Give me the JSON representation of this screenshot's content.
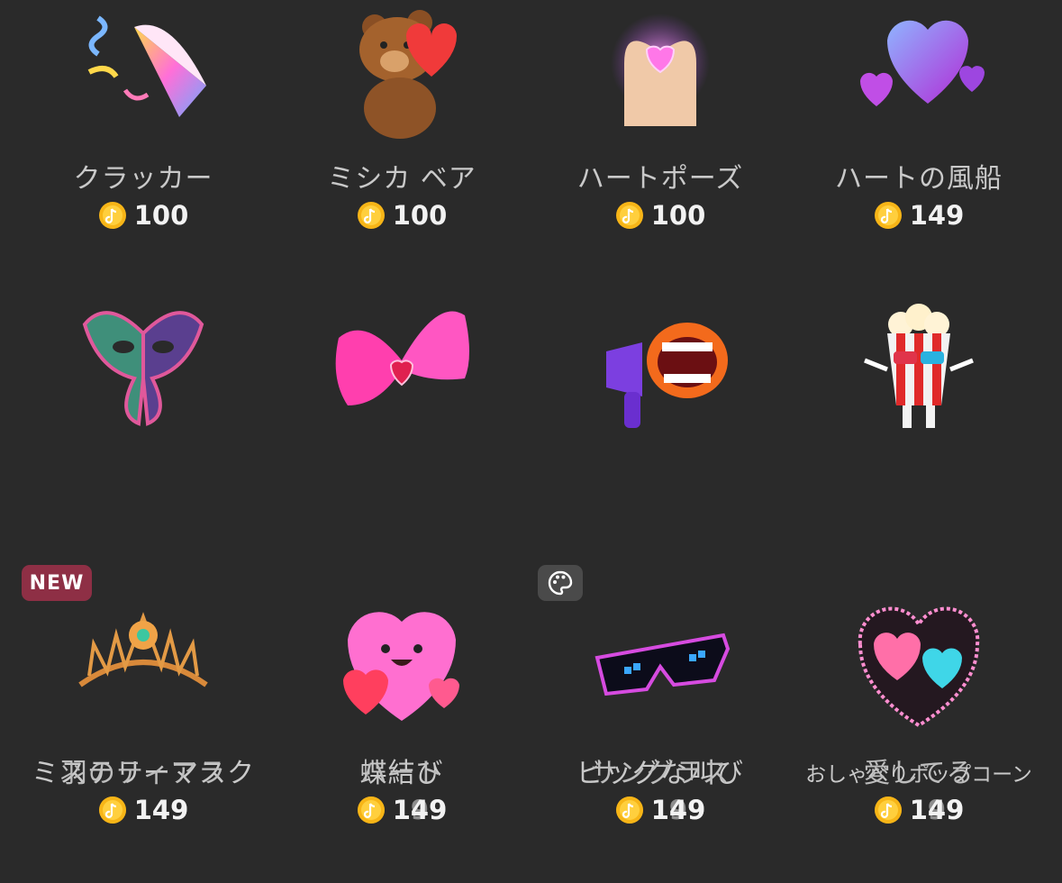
{
  "gifts": [
    {
      "name": "クラッカー",
      "price": "100",
      "icon": "party-popper-icon"
    },
    {
      "name": "ミシカ ベア",
      "price": "100",
      "icon": "teddy-bear-heart-icon"
    },
    {
      "name": "ハートポーズ",
      "price": "100",
      "icon": "heart-hands-icon"
    },
    {
      "name": "ハートの風船",
      "price": "149",
      "icon": "heart-balloon-icon"
    },
    {
      "name": "ミステリーマスク",
      "price": "149",
      "icon": "butterfly-mask-icon"
    },
    {
      "name": "蝶結び",
      "price": "149",
      "icon": "pink-bow-icon"
    },
    {
      "name": "ビッグな叫び",
      "price": "149",
      "icon": "megaphone-mouth-icon"
    },
    {
      "name": "おしゃべりポップコーン",
      "price": "149",
      "icon": "popcorn-character-icon"
    },
    {
      "name": "羽のティアラ",
      "price": "149",
      "icon": "tiara-icon"
    },
    {
      "name": "ハート",
      "price": "199",
      "icon": "pink-heart-character-icon"
    },
    {
      "name": "サングラス",
      "price": "199",
      "icon": "pixel-sunglasses-icon"
    },
    {
      "name": "愛してる",
      "price": "199",
      "icon": "love-heart-frame-icon"
    }
  ],
  "badges": {
    "new_label": "NEW",
    "palette_icon": "palette-icon"
  },
  "coin_icon": "coin-icon",
  "colors": {
    "background": "#2a2a2a",
    "coin": "#f7b517",
    "new_badge": "#8e2f45"
  }
}
